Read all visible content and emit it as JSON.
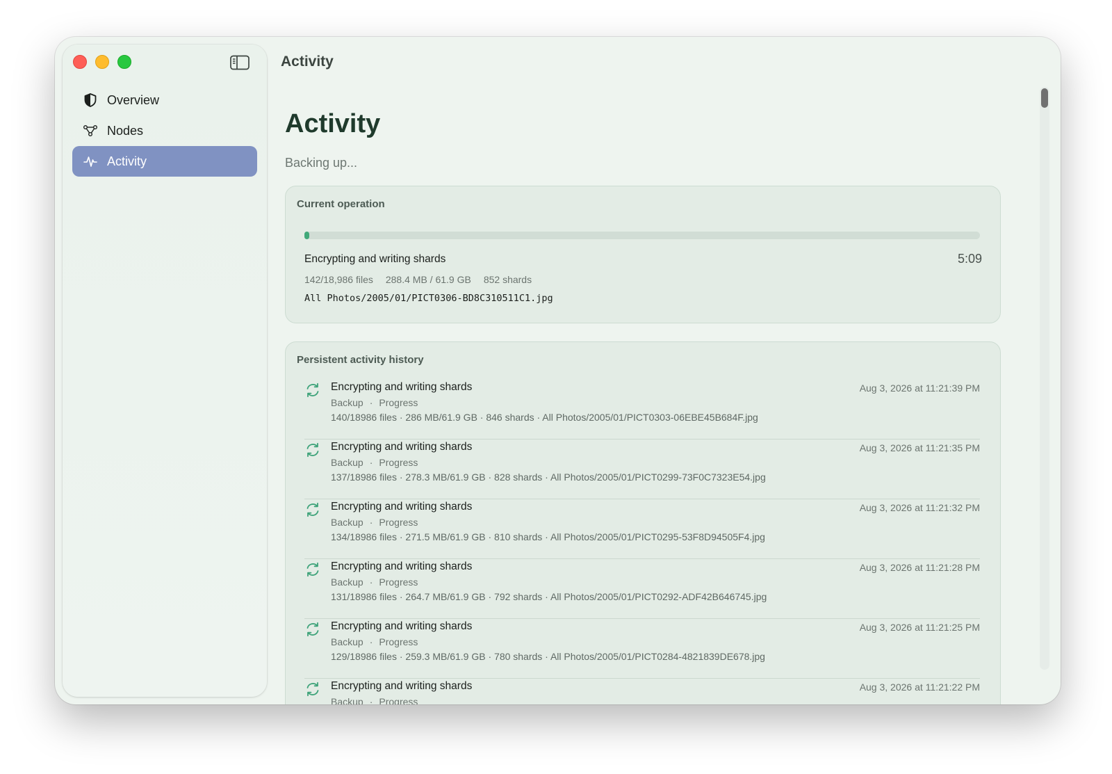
{
  "window": {
    "title": "Activity"
  },
  "sidebar": {
    "items": [
      {
        "label": "Overview",
        "icon": "shield-icon",
        "active": false
      },
      {
        "label": "Nodes",
        "icon": "nodes-icon",
        "active": false
      },
      {
        "label": "Activity",
        "icon": "activity-pulse-icon",
        "active": true
      }
    ]
  },
  "main": {
    "title": "Activity",
    "status": "Backing up...",
    "current_operation": {
      "heading": "Current operation",
      "progress_fraction": 0.0075,
      "name": "Encrypting and writing shards",
      "elapsed": "5:09",
      "files": "142/18,986 files",
      "size": "288.4 MB / 61.9 GB",
      "shards": "852 shards",
      "path": "All Photos/2005/01/PICT0306-BD8C310511C1.jpg"
    },
    "history": {
      "heading": "Persistent activity history",
      "items": [
        {
          "name": "Encrypting and writing shards",
          "category": "Backup",
          "type": "Progress",
          "timestamp": "Aug 3, 2026 at 11:21:39 PM",
          "detail": "140/18986 files · 286 MB/61.9 GB · 846 shards · All Photos/2005/01/PICT0303-06EBE45B684F.jpg"
        },
        {
          "name": "Encrypting and writing shards",
          "category": "Backup",
          "type": "Progress",
          "timestamp": "Aug 3, 2026 at 11:21:35 PM",
          "detail": "137/18986 files · 278.3 MB/61.9 GB · 828 shards · All Photos/2005/01/PICT0299-73F0C7323E54.jpg"
        },
        {
          "name": "Encrypting and writing shards",
          "category": "Backup",
          "type": "Progress",
          "timestamp": "Aug 3, 2026 at 11:21:32 PM",
          "detail": "134/18986 files · 271.5 MB/61.9 GB · 810 shards · All Photos/2005/01/PICT0295-53F8D94505F4.jpg"
        },
        {
          "name": "Encrypting and writing shards",
          "category": "Backup",
          "type": "Progress",
          "timestamp": "Aug 3, 2026 at 11:21:28 PM",
          "detail": "131/18986 files · 264.7 MB/61.9 GB · 792 shards · All Photos/2005/01/PICT0292-ADF42B646745.jpg"
        },
        {
          "name": "Encrypting and writing shards",
          "category": "Backup",
          "type": "Progress",
          "timestamp": "Aug 3, 2026 at 11:21:25 PM",
          "detail": "129/18986 files · 259.3 MB/61.9 GB · 780 shards · All Photos/2005/01/PICT0284-4821839DE678.jpg"
        },
        {
          "name": "Encrypting and writing shards",
          "category": "Backup",
          "type": "Progress",
          "timestamp": "Aug 3, 2026 at 11:21:22 PM",
          "detail": ""
        }
      ]
    }
  },
  "colors": {
    "accent_selected": "#8092c2",
    "progress": "#41a97a",
    "sync_icon": "#3fa37a"
  }
}
